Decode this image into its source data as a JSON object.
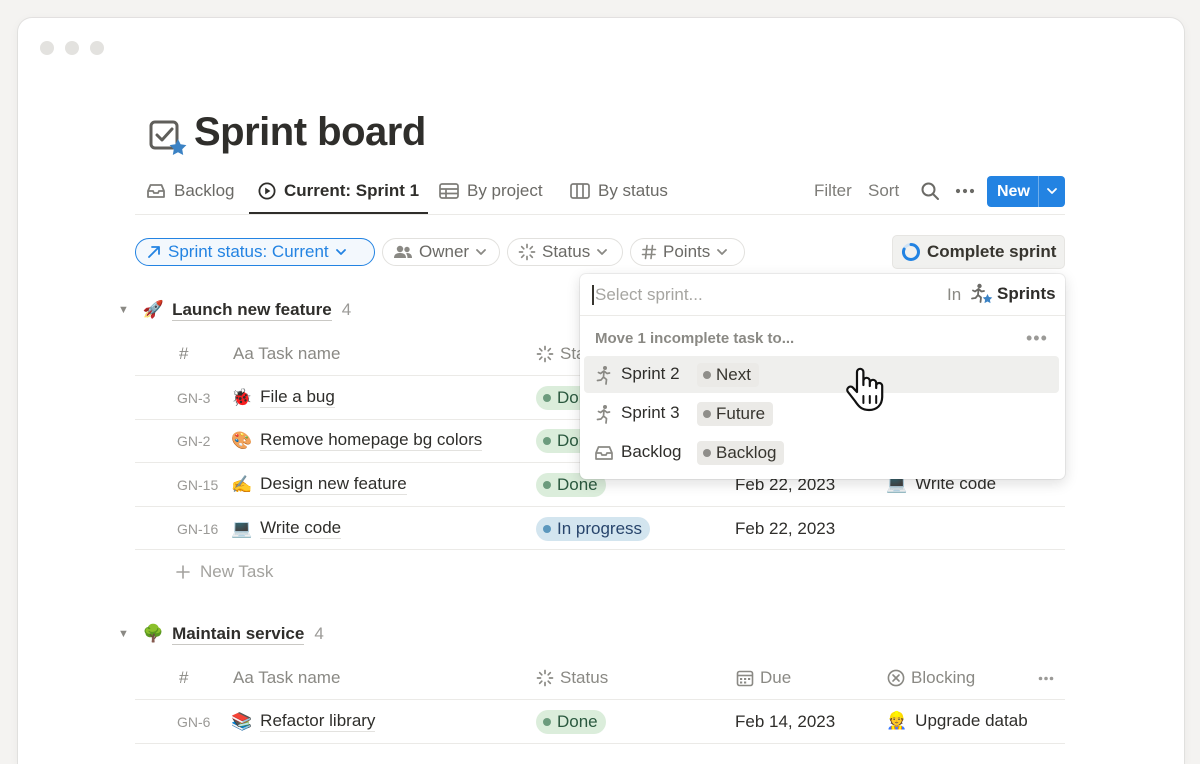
{
  "page": {
    "title": "Sprint board",
    "icon": "checkbox-star-icon"
  },
  "tabs": [
    {
      "label": "Backlog",
      "icon": "inbox-icon"
    },
    {
      "label": "Current: Sprint 1",
      "icon": "play-circle-icon",
      "active": true
    },
    {
      "label": "By project",
      "icon": "table-icon"
    },
    {
      "label": "By status",
      "icon": "board-icon"
    }
  ],
  "toolbar": {
    "filter_label": "Filter",
    "sort_label": "Sort",
    "new_label": "New",
    "accent_color": "#2383e2"
  },
  "filters": {
    "sprint_status": "Sprint status: Current",
    "owner": "Owner",
    "status": "Status",
    "points": "Points",
    "complete_sprint": "Complete sprint"
  },
  "columns": {
    "id": "#",
    "task": "Aa Task name",
    "status": "Status",
    "due": "Due",
    "blocking": "Blocking"
  },
  "groups": [
    {
      "emoji": "🚀",
      "title": "Launch new feature",
      "count": "4",
      "rows": [
        {
          "id": "GN-3",
          "emoji": "🐞",
          "name": "File a bug",
          "status": "Done",
          "due": "",
          "blocking": ""
        },
        {
          "id": "GN-2",
          "emoji": "🎨",
          "name": "Remove homepage bg colors",
          "status": "Done",
          "due": "",
          "blocking": ""
        },
        {
          "id": "GN-15",
          "emoji": "✍️",
          "name": "Design new feature",
          "status": "Done",
          "due": "Feb 22, 2023",
          "blocking_emoji": "💻",
          "blocking": "Write code"
        },
        {
          "id": "GN-16",
          "emoji": "💻",
          "name": "Write code",
          "status": "In progress",
          "due": "Feb 22, 2023",
          "blocking": ""
        }
      ],
      "new_task_label": "New Task"
    },
    {
      "emoji": "🌳",
      "title": "Maintain service",
      "count": "4",
      "rows": [
        {
          "id": "GN-6",
          "emoji": "📚",
          "name": "Refactor library",
          "status": "Done",
          "due": "Feb 14, 2023",
          "blocking_emoji": "👷",
          "blocking": "Upgrade datab"
        }
      ]
    }
  ],
  "popover": {
    "placeholder": "Select sprint...",
    "in_label": "In",
    "database": "Sprints",
    "section_title": "Move 1 incomplete task to...",
    "options": [
      {
        "label": "Sprint 2",
        "tag": "Next",
        "icon": "runner-icon"
      },
      {
        "label": "Sprint 3",
        "tag": "Future",
        "icon": "runner-icon"
      },
      {
        "label": "Backlog",
        "tag": "Backlog",
        "icon": "inbox-icon"
      }
    ]
  }
}
